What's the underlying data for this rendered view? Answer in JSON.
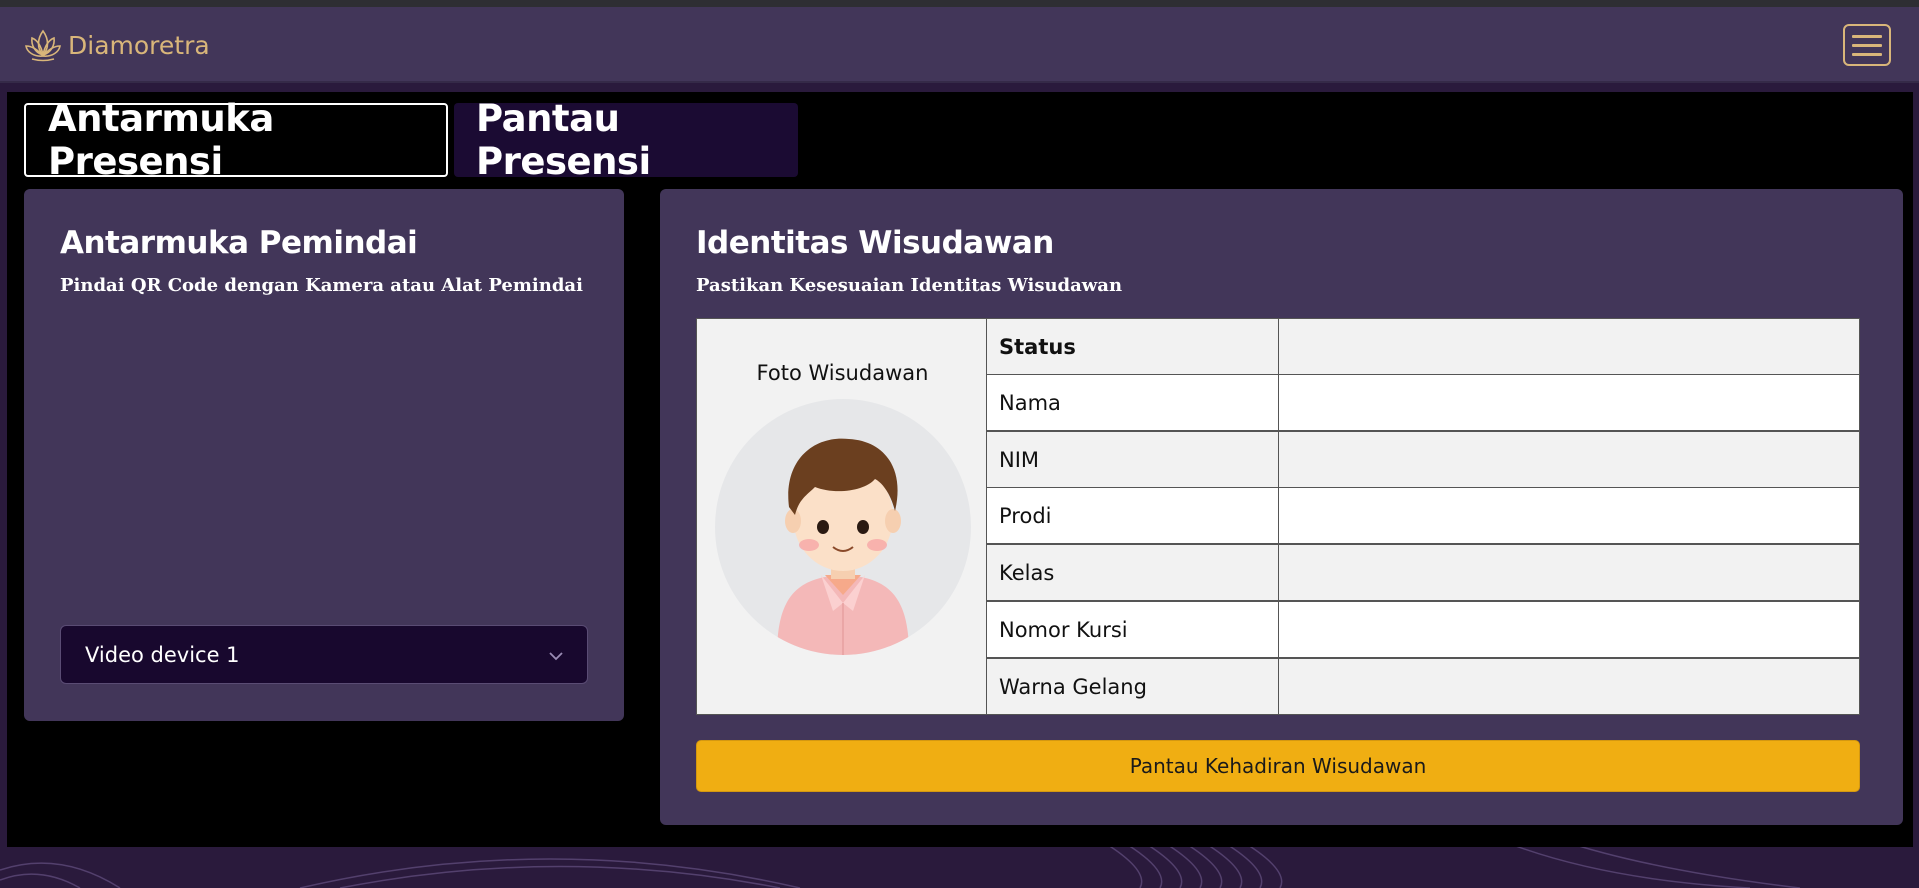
{
  "navbar": {
    "brand_name": "Diamoretra",
    "brand_icon": "lotus-icon",
    "menu_icon": "hamburger-icon"
  },
  "tabs": [
    {
      "label": "Antarmuka Presensi",
      "active": true
    },
    {
      "label": "Pantau Presensi",
      "active": false
    }
  ],
  "scanner": {
    "title": "Antarmuka Pemindai",
    "subtitle": "Pindai QR Code dengan Kamera atau Alat Pemindai",
    "device_select": {
      "selected": "Video device 1"
    }
  },
  "identity": {
    "title": "Identitas Wisudawan",
    "subtitle": "Pastikan Kesesuaian Identitas Wisudawan",
    "photo_label": "Foto Wisudawan",
    "rows": [
      {
        "label": "Status",
        "value": ""
      },
      {
        "label": "Nama",
        "value": ""
      },
      {
        "label": "NIM",
        "value": ""
      },
      {
        "label": "Prodi",
        "value": ""
      },
      {
        "label": "Kelas",
        "value": ""
      },
      {
        "label": "Nomor Kursi",
        "value": ""
      },
      {
        "label": "Warna Gelang",
        "value": ""
      }
    ],
    "monitor_button": "Pantau Kehadiran Wisudawan"
  },
  "colors": {
    "navbar_bg": "#423659",
    "card_bg": "#423659",
    "brand_gold": "#d9b67a",
    "button_yellow": "#f0ae12",
    "inactive_tab_bg": "#1b0b33"
  }
}
